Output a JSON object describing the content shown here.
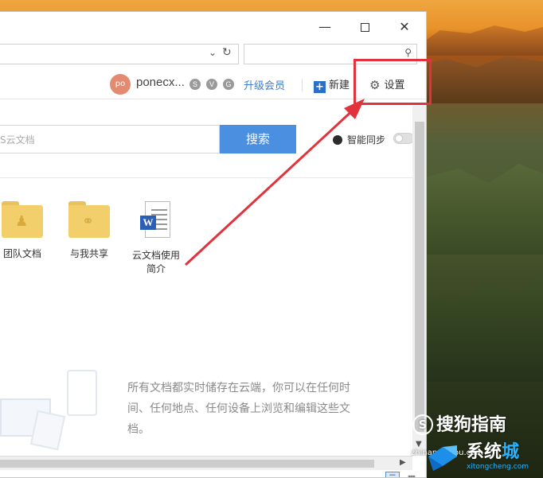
{
  "window": {
    "controls": {
      "minimize": "—",
      "close": "✕"
    }
  },
  "address_bar": {
    "value": "",
    "dropdown": "⌄",
    "refresh": "↻"
  },
  "top_search": {
    "value": "",
    "icon": "search-icon"
  },
  "toolbar": {
    "avatar_initials": "po",
    "username": "ponecx...",
    "badges": [
      "S",
      "V",
      "G"
    ],
    "upgrade_label": "升级会员",
    "new_label": "新建",
    "settings_label": "设置"
  },
  "search": {
    "placeholder": "S云文档",
    "button_label": "搜索"
  },
  "sync": {
    "label": "智能同步",
    "enabled": false
  },
  "files": [
    {
      "name": "团队文档",
      "type": "folder",
      "icon": "person-icon"
    },
    {
      "name": "与我共享",
      "type": "folder",
      "icon": "link-icon"
    },
    {
      "name_line1": "云文档使用",
      "name_line2": "简介",
      "type": "word-doc",
      "icon": "word-icon"
    }
  ],
  "empty_state": {
    "text": "所有文档都实时储存在云端，你可以在任何时间、任何地点、任何设备上浏览和编辑这些文档。"
  },
  "watermark": {
    "sogou": "搜狗指南",
    "url": "zhinan.sogou.com",
    "xitong_a": "系统",
    "xitong_b": "城",
    "pinyin": "xitongcheng.com"
  },
  "colors": {
    "accent": "#4a8fe0",
    "annotation_red": "#e2333d",
    "upgrade_link": "#3a7cd6",
    "folder": "#f2cf6b"
  }
}
